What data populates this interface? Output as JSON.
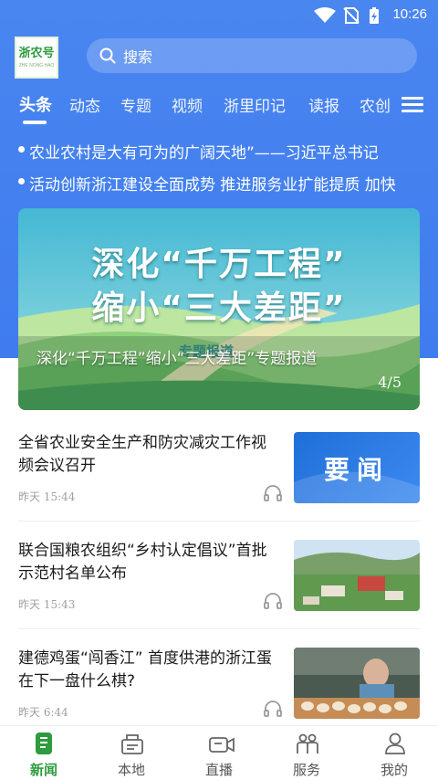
{
  "status_bar": {
    "time": "10:26"
  },
  "header": {
    "logo_text": "浙农号",
    "logo_sub": "ZHE NONG HAO",
    "search_placeholder": "搜索"
  },
  "tabs": [
    "头条",
    "动态",
    "专题",
    "视频",
    "浙里印记",
    "读报",
    "农创"
  ],
  "active_tab": "头条",
  "ticker": [
    "农业农村是大有可为的广阔天地”——习近平总书记",
    "活动创新浙江建设全面成势 推进服务业扩能提质 加快"
  ],
  "banner": {
    "headline_line1": "深化“千万工程”",
    "headline_line2": "缩小“三大差距”",
    "caption": "深化“千万工程”缩小“三大差距”专题报道",
    "overlay_tag": "专题报道",
    "page_indicator": "4/5"
  },
  "news": [
    {
      "title": "全省农业安全生产和防灾减灾工作视频会议召开",
      "time": "昨天 15:44",
      "thumb_text": "要闻"
    },
    {
      "title": "联合国粮农组织“乡村认定倡议”首批示范村名单公布",
      "time": "昨天 15:43",
      "thumb_text": ""
    },
    {
      "title": "建德鸡蛋“闯香江” 首度供港的浙江蛋在下一盘什么棋?",
      "time": "昨天 6:44",
      "thumb_text": ""
    }
  ],
  "bottom_nav": [
    {
      "label": "新闻",
      "icon": "news-icon",
      "active": true
    },
    {
      "label": "本地",
      "icon": "local-icon",
      "active": false
    },
    {
      "label": "直播",
      "icon": "live-camera-icon",
      "active": false
    },
    {
      "label": "服务",
      "icon": "service-icon",
      "active": false
    },
    {
      "label": "我的",
      "icon": "profile-icon",
      "active": false
    }
  ],
  "colors": {
    "primary_blue": "#4485f0",
    "active_green": "#2e9b3f",
    "time_gray": "#a0a0a0"
  }
}
